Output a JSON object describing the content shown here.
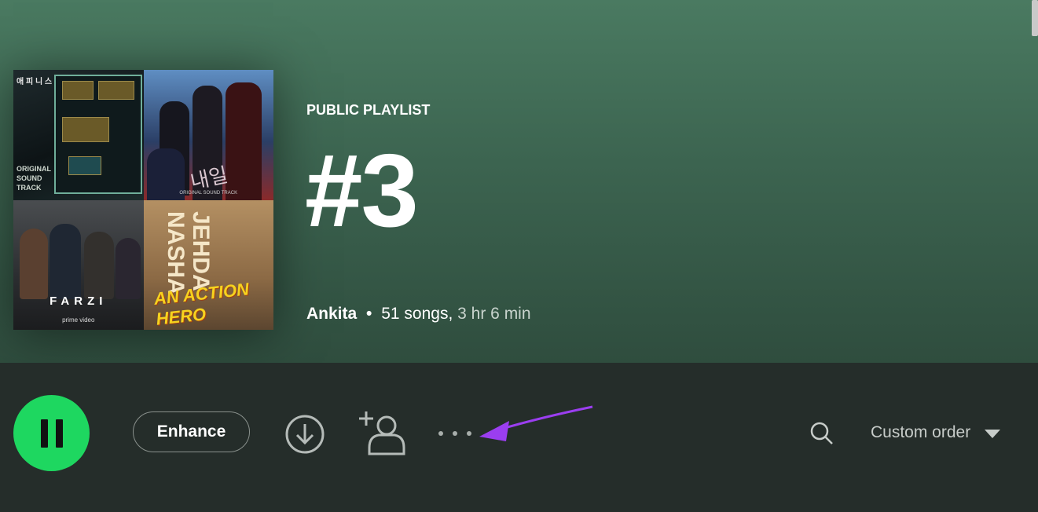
{
  "playlist": {
    "type_label": "PUBLIC PLAYLIST",
    "title": "#3",
    "owner": "Ankita",
    "separator": "•",
    "song_count": "51 songs,",
    "duration": "3 hr 6 min"
  },
  "cover": {
    "tile1": {
      "top_text": "애 피 니 스",
      "bottom_text_1": "ORIGINAL",
      "bottom_text_2": "SOUND",
      "bottom_text_3": "TRACK"
    },
    "tile2": {
      "logo_text": "내일",
      "caption": "ORIGINAL SOUND TRACK"
    },
    "tile3": {
      "title": "FARZI",
      "caption": "prime video"
    },
    "tile4": {
      "title_1": "JEHDA",
      "title_2": "NASHA",
      "subtitle": "AN ACTION HERO"
    }
  },
  "controls": {
    "enhance_label": "Enhance",
    "sort_label": "Custom order"
  },
  "colors": {
    "accent": "#1ed760",
    "header_top": "#4a7a61",
    "background": "#252d2a",
    "annotation_arrow": "#9b3ef0"
  },
  "icons": {
    "play": "pause-icon",
    "download": "download-circle-icon",
    "invite": "add-user-icon",
    "more": "more-options-icon",
    "search": "search-icon",
    "sort": "caret-down-icon"
  }
}
